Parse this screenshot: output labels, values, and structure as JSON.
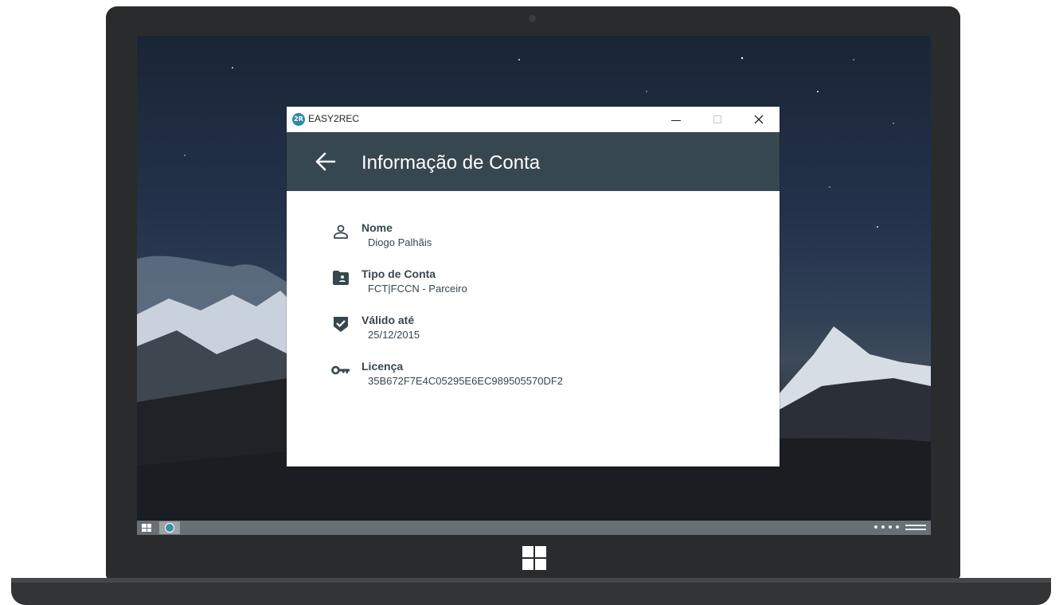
{
  "window": {
    "title": "EASY2REC",
    "logo_text": "2R"
  },
  "window_controls": {
    "minimize": "minimize",
    "maximize": "maximize",
    "close": "close"
  },
  "appbar": {
    "title": "Informação de Conta"
  },
  "account_info": {
    "items": [
      {
        "icon": "person-icon",
        "label": "Nome",
        "value": "Diogo Palhãis"
      },
      {
        "icon": "account-card-folder-icon",
        "label": "Tipo de Conta",
        "value": "FCT|FCCN - Parceiro"
      },
      {
        "icon": "verified-shield-icon",
        "label": "Válido até",
        "value": "25/12/2015"
      },
      {
        "icon": "key-icon",
        "label": "Licença",
        "value": "35B672F7E4C05295E6EC989505570DF2"
      }
    ]
  },
  "colors": {
    "appbar": "#37474f",
    "text": "#37474f",
    "app_logo": "#2f8aa3",
    "laptop_frame": "#2a2b2d"
  }
}
